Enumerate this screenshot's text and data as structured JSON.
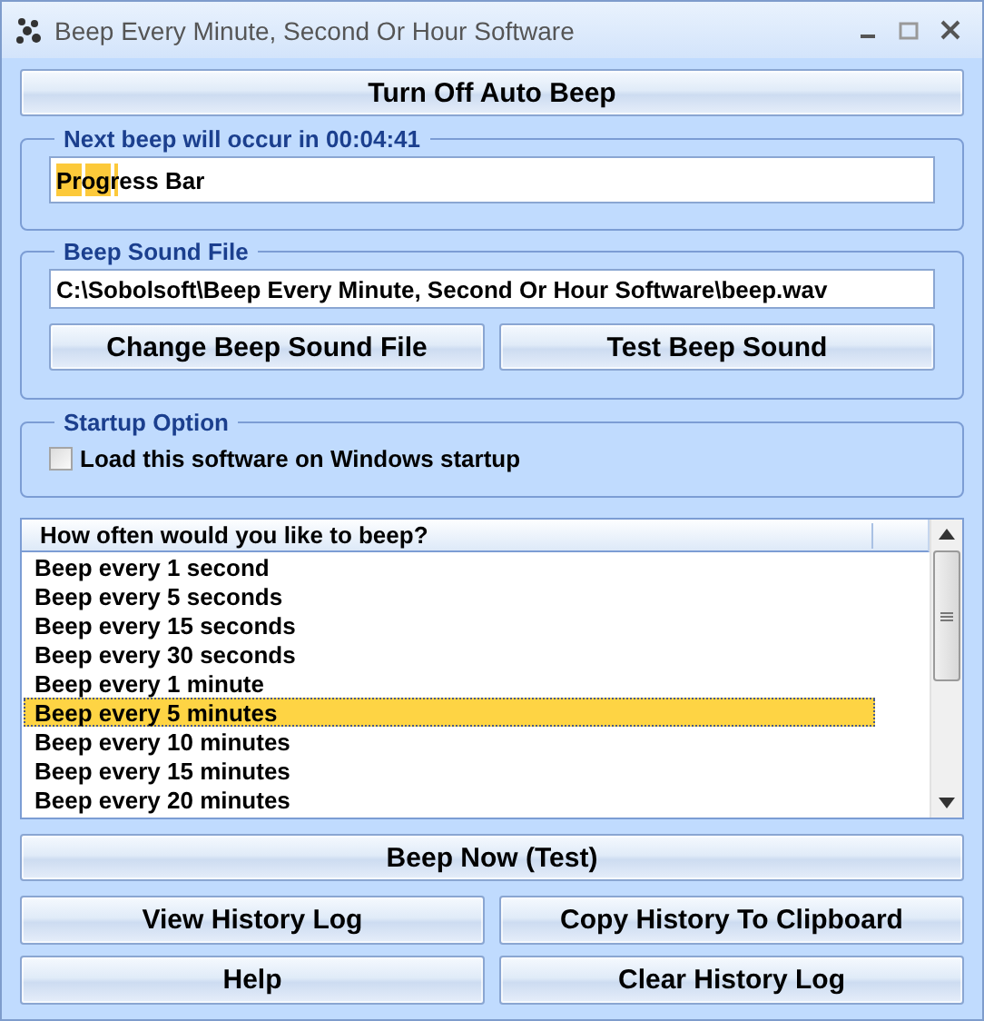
{
  "window": {
    "title": "Beep Every Minute, Second Or Hour Software"
  },
  "auto_beep_button": "Turn Off Auto Beep",
  "countdown": {
    "label": "Next beep will occur in 00:04:41",
    "progress": {
      "text": "Progress Bar",
      "level": 0.07
    }
  },
  "sound_file": {
    "label": "Beep Sound File",
    "path": "C:\\Sobolsoft\\Beep Every Minute, Second Or Hour Software\\beep.wav",
    "buttons": [
      "Change Beep Sound File",
      "Test Beep Sound"
    ]
  },
  "startup": {
    "label": "Startup Option",
    "checkbox": {
      "label": "Load this software on Windows startup",
      "checked": false
    }
  },
  "interval_list": {
    "column": "How often would you like to beep?",
    "items": [
      {
        "label": "Beep every 1 second",
        "selected": false
      },
      {
        "label": "Beep every 5 seconds",
        "selected": false
      },
      {
        "label": "Beep every 15 seconds",
        "selected": false
      },
      {
        "label": "Beep every 30 seconds",
        "selected": false
      },
      {
        "label": "Beep every 1 minute",
        "selected": false
      },
      {
        "label": "Beep every 5 minutes",
        "selected": true
      },
      {
        "label": "Beep every 10 minutes",
        "selected": false
      },
      {
        "label": "Beep every 15 minutes",
        "selected": false
      },
      {
        "label": "Beep every 20 minutes",
        "selected": false
      }
    ]
  },
  "beep_now_button": "Beep Now (Test)",
  "button_rows": [
    [
      "View History Log",
      "Copy History To Clipboard"
    ],
    [
      "Help",
      "Clear History Log"
    ]
  ]
}
